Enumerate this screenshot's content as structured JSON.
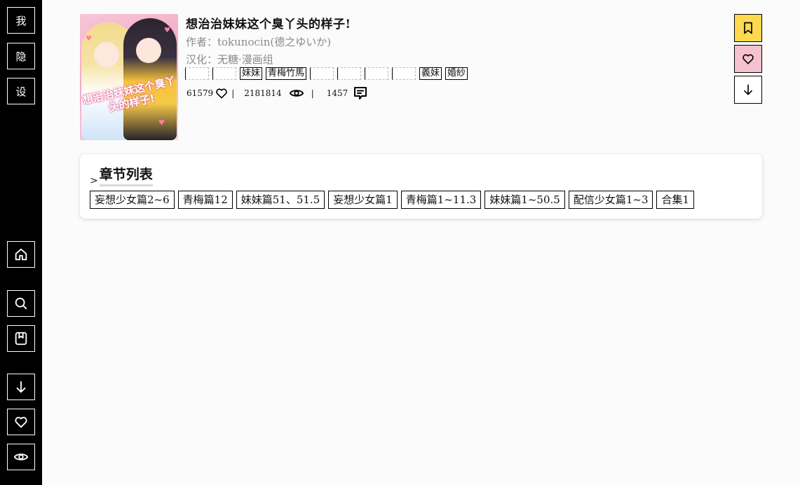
{
  "sidebar": {
    "top_buttons": [
      "我",
      "隐",
      "设"
    ]
  },
  "comic": {
    "cover_title": "想治治妹妹这个臭丫头的样子!",
    "title": "想治治妹妹这个臭丫头的样子!",
    "author": "作者：tokunocin(德之ゆいか)",
    "translator": "汉化：无糖·漫画组",
    "tags": [
      "",
      "",
      "妹妹",
      "青梅竹馬",
      "",
      "",
      "",
      "",
      "義妹",
      "婚紗"
    ],
    "likes": "61579",
    "views": "2181814",
    "comments": "1457",
    "separator": "|"
  },
  "actions": {
    "bookmark_color": "#ffd84d",
    "favorite_color": "#f5c2d0"
  },
  "chapters": {
    "heading": "章节列表",
    "chevron": ">",
    "items": [
      "妄想少女篇2~6",
      "青梅篇12",
      "妹妹篇51、51.5",
      "妄想少女篇1",
      "青梅篇1~11.3",
      "妹妹篇1~50.5",
      "配信少女篇1~3",
      "合集1"
    ]
  }
}
